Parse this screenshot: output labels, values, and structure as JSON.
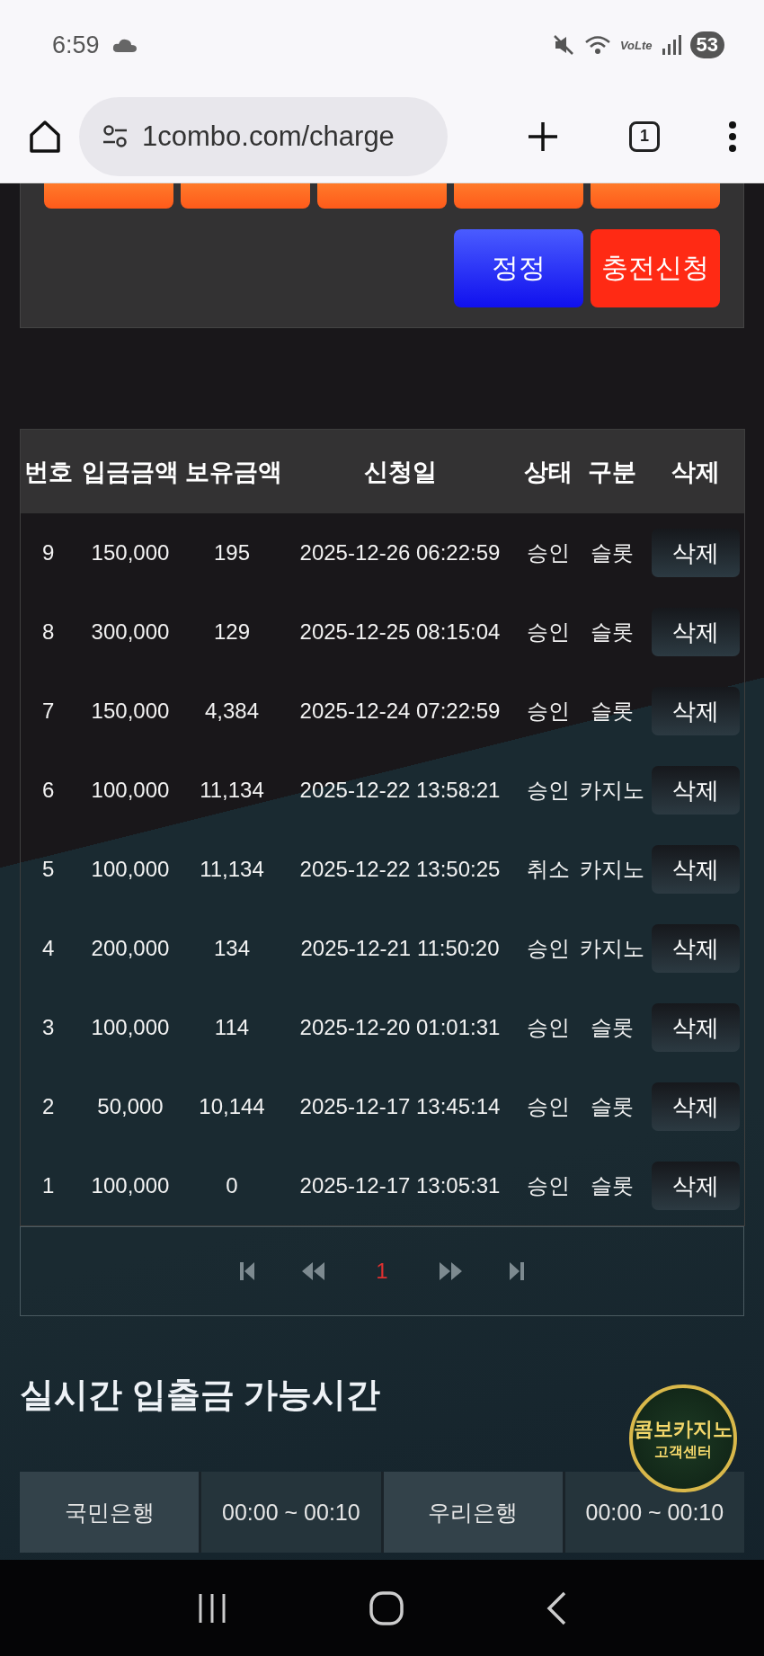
{
  "status_bar": {
    "time": "6:59",
    "network_label": "VoLte",
    "battery": "53"
  },
  "browser": {
    "url": "1combo.com/charge",
    "tab_count": "1"
  },
  "actions": [
    {
      "label": "정정",
      "kind": "correct"
    },
    {
      "label": "충전신청",
      "kind": "apply"
    }
  ],
  "table": {
    "columns": [
      "번호",
      "입금금액",
      "보유금액",
      "신청일",
      "상태",
      "구분",
      "삭제"
    ],
    "rows": [
      {
        "no": "9",
        "amount": "150,000",
        "balance": "195",
        "date": "2025-12-26 06:22:59",
        "status": "승인",
        "category": "슬롯",
        "action": "삭제"
      },
      {
        "no": "8",
        "amount": "300,000",
        "balance": "129",
        "date": "2025-12-25 08:15:04",
        "status": "승인",
        "category": "슬롯",
        "action": "삭제"
      },
      {
        "no": "7",
        "amount": "150,000",
        "balance": "4,384",
        "date": "2025-12-24 07:22:59",
        "status": "승인",
        "category": "슬롯",
        "action": "삭제"
      },
      {
        "no": "6",
        "amount": "100,000",
        "balance": "11,134",
        "date": "2025-12-22 13:58:21",
        "status": "승인",
        "category": "카지노",
        "action": "삭제"
      },
      {
        "no": "5",
        "amount": "100,000",
        "balance": "11,134",
        "date": "2025-12-22 13:50:25",
        "status": "취소",
        "category": "카지노",
        "action": "삭제"
      },
      {
        "no": "4",
        "amount": "200,000",
        "balance": "134",
        "date": "2025-12-21 11:50:20",
        "status": "승인",
        "category": "카지노",
        "action": "삭제"
      },
      {
        "no": "3",
        "amount": "100,000",
        "balance": "114",
        "date": "2025-12-20 01:01:31",
        "status": "승인",
        "category": "슬롯",
        "action": "삭제"
      },
      {
        "no": "2",
        "amount": "50,000",
        "balance": "10,144",
        "date": "2025-12-17 13:45:14",
        "status": "승인",
        "category": "슬롯",
        "action": "삭제"
      },
      {
        "no": "1",
        "amount": "100,000",
        "balance": "0",
        "date": "2025-12-17 13:05:31",
        "status": "승인",
        "category": "슬롯",
        "action": "삭제"
      }
    ]
  },
  "pagination": {
    "pages": [
      {
        "label": "1",
        "selected": true
      }
    ]
  },
  "section_title": "실시간 입출금 가능시간",
  "bank_hours": [
    {
      "bank": "국민은행",
      "hours": "00:00 ~ 00:10"
    },
    {
      "bank": "우리은행",
      "hours": "00:00 ~ 00:10"
    }
  ],
  "support_badge": {
    "title": "콤보카지노",
    "subtitle": "고객센터"
  }
}
